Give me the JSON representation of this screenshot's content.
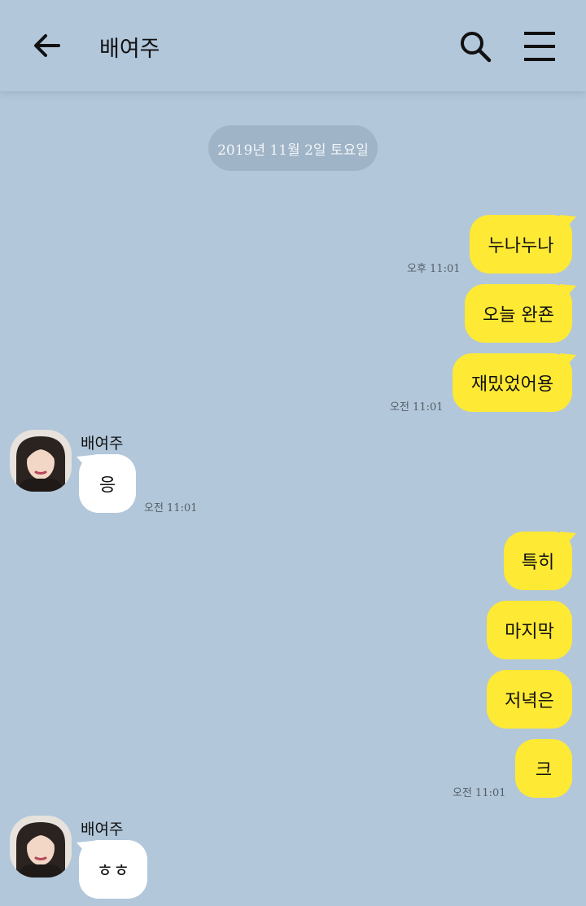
{
  "header": {
    "title": "배여주",
    "back_icon": "arrow-left-icon",
    "search_icon": "search-icon",
    "menu_icon": "hamburger-menu-icon"
  },
  "date_divider": "2019년 11월 2일 토요일",
  "colors": {
    "background": "#b2c7da",
    "my_bubble": "#fee934",
    "their_bubble": "#ffffff"
  },
  "messages": [
    {
      "from": "me",
      "text": "누나누나",
      "time": "오후 11:01"
    },
    {
      "from": "me",
      "text": "오늘 완죤"
    },
    {
      "from": "me",
      "text": "재밌었어용",
      "time": "오전 11:01"
    },
    {
      "from": "them",
      "sender": "배여주",
      "text": "응",
      "time": "오전 11:01"
    },
    {
      "from": "me",
      "text": "특히"
    },
    {
      "from": "me",
      "text": "마지막"
    },
    {
      "from": "me",
      "text": "저녁은"
    },
    {
      "from": "me",
      "text": "크",
      "time": "오전 11:01"
    },
    {
      "from": "them",
      "sender": "배여주",
      "text": "ㅎㅎ"
    }
  ]
}
